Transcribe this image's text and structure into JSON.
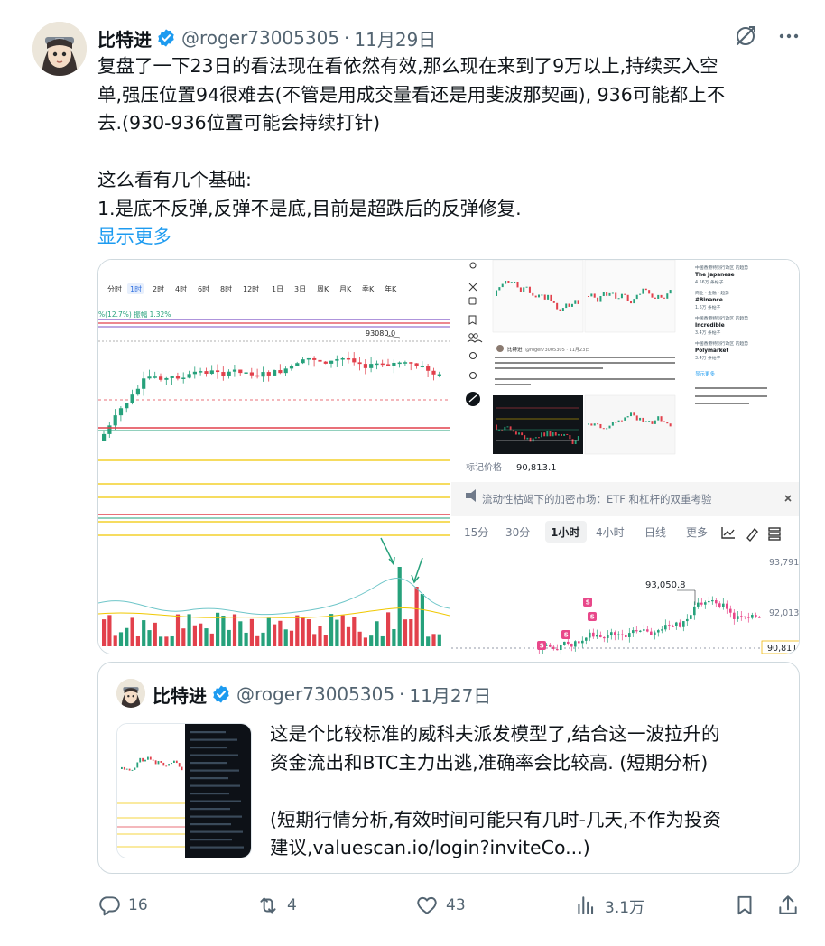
{
  "tweet": {
    "author_name": "比特进",
    "handle": "@roger73005305",
    "separator": "·",
    "date": "11月29日",
    "lines": [
      "复盘了一下23日的看法现在看依然有效,那么现在来到了9万以上,持续买入空",
      "单,强压位置94很难去(不管是用成交量看还是用斐波那契画), 936可能都上不",
      "去.(930-936位置可能会持续打针)",
      "",
      "这么看有几个基础:",
      "1.是底不反弹,反弹不是底,目前是超跌后的反弹修复."
    ],
    "show_more": "显示更多"
  },
  "media_left": {
    "timeframes": [
      "分时",
      "1时",
      "2时",
      "4时",
      "6时",
      "8时",
      "12时",
      "1日",
      "3日",
      "周K",
      "月K",
      "季K",
      "年K"
    ],
    "active_timeframe": "1时",
    "amplitude_text": "%(12.7%)  振幅 1.32%",
    "high_label": "93080.0",
    "bull_color": "#26a17b",
    "bear_color": "#e2414c"
  },
  "media_right": {
    "mark_price_label": "标记价格",
    "mark_price_value": "90,813.1",
    "news_title": "流动性枯竭下的加密市场：ETF 和杠杆的双重考验",
    "tabs": [
      "15分",
      "30分",
      "1小时",
      "4小时",
      "日线",
      "更多"
    ],
    "active_tab": "1小时",
    "price_high": "93,050.8",
    "axis_labels": [
      "93,791",
      "92,013",
      "90,811"
    ],
    "trend_items": [
      {
        "category": "中国香港特别行政区 的趋势",
        "title": "The Japanese",
        "count": "4.56万 条帖子"
      },
      {
        "category": "商业 · 金融 · 趋势",
        "title": "#Binance",
        "count": "1.6万 条帖子"
      },
      {
        "category": "中国香港特别行政区 的趋势",
        "title": "Incredible",
        "count": "3.4万 条帖子"
      },
      {
        "category": "中国香港特别行政区 的趋势",
        "title": "Polymarket",
        "count": "3.4万 条帖子"
      }
    ],
    "show_more": "显示更多",
    "inner_tweet_author": "比特进",
    "inner_tweet_handle": "@roger73005305 · 11月23日"
  },
  "quote": {
    "author_name": "比特进",
    "handle": "@roger73005305",
    "separator": "·",
    "date": "11月27日",
    "lines": [
      "这是个比较标准的威科夫派发模型了,结合这一波拉升的",
      "资金流出和BTC主力出逃,准确率会比较高. (短期分析)",
      "",
      "(短期行情分析,有效时间可能只有几时-几天,不作为投资",
      "建议,valuescan.io/login?inviteCo...)"
    ]
  },
  "actions": {
    "replies": "16",
    "reposts": "4",
    "likes": "43",
    "views": "3.1万"
  },
  "colors": {
    "link": "#1d9bf0",
    "secondary_text": "#536471",
    "verified": "#1d9bf0",
    "border": "#cfd9de"
  }
}
